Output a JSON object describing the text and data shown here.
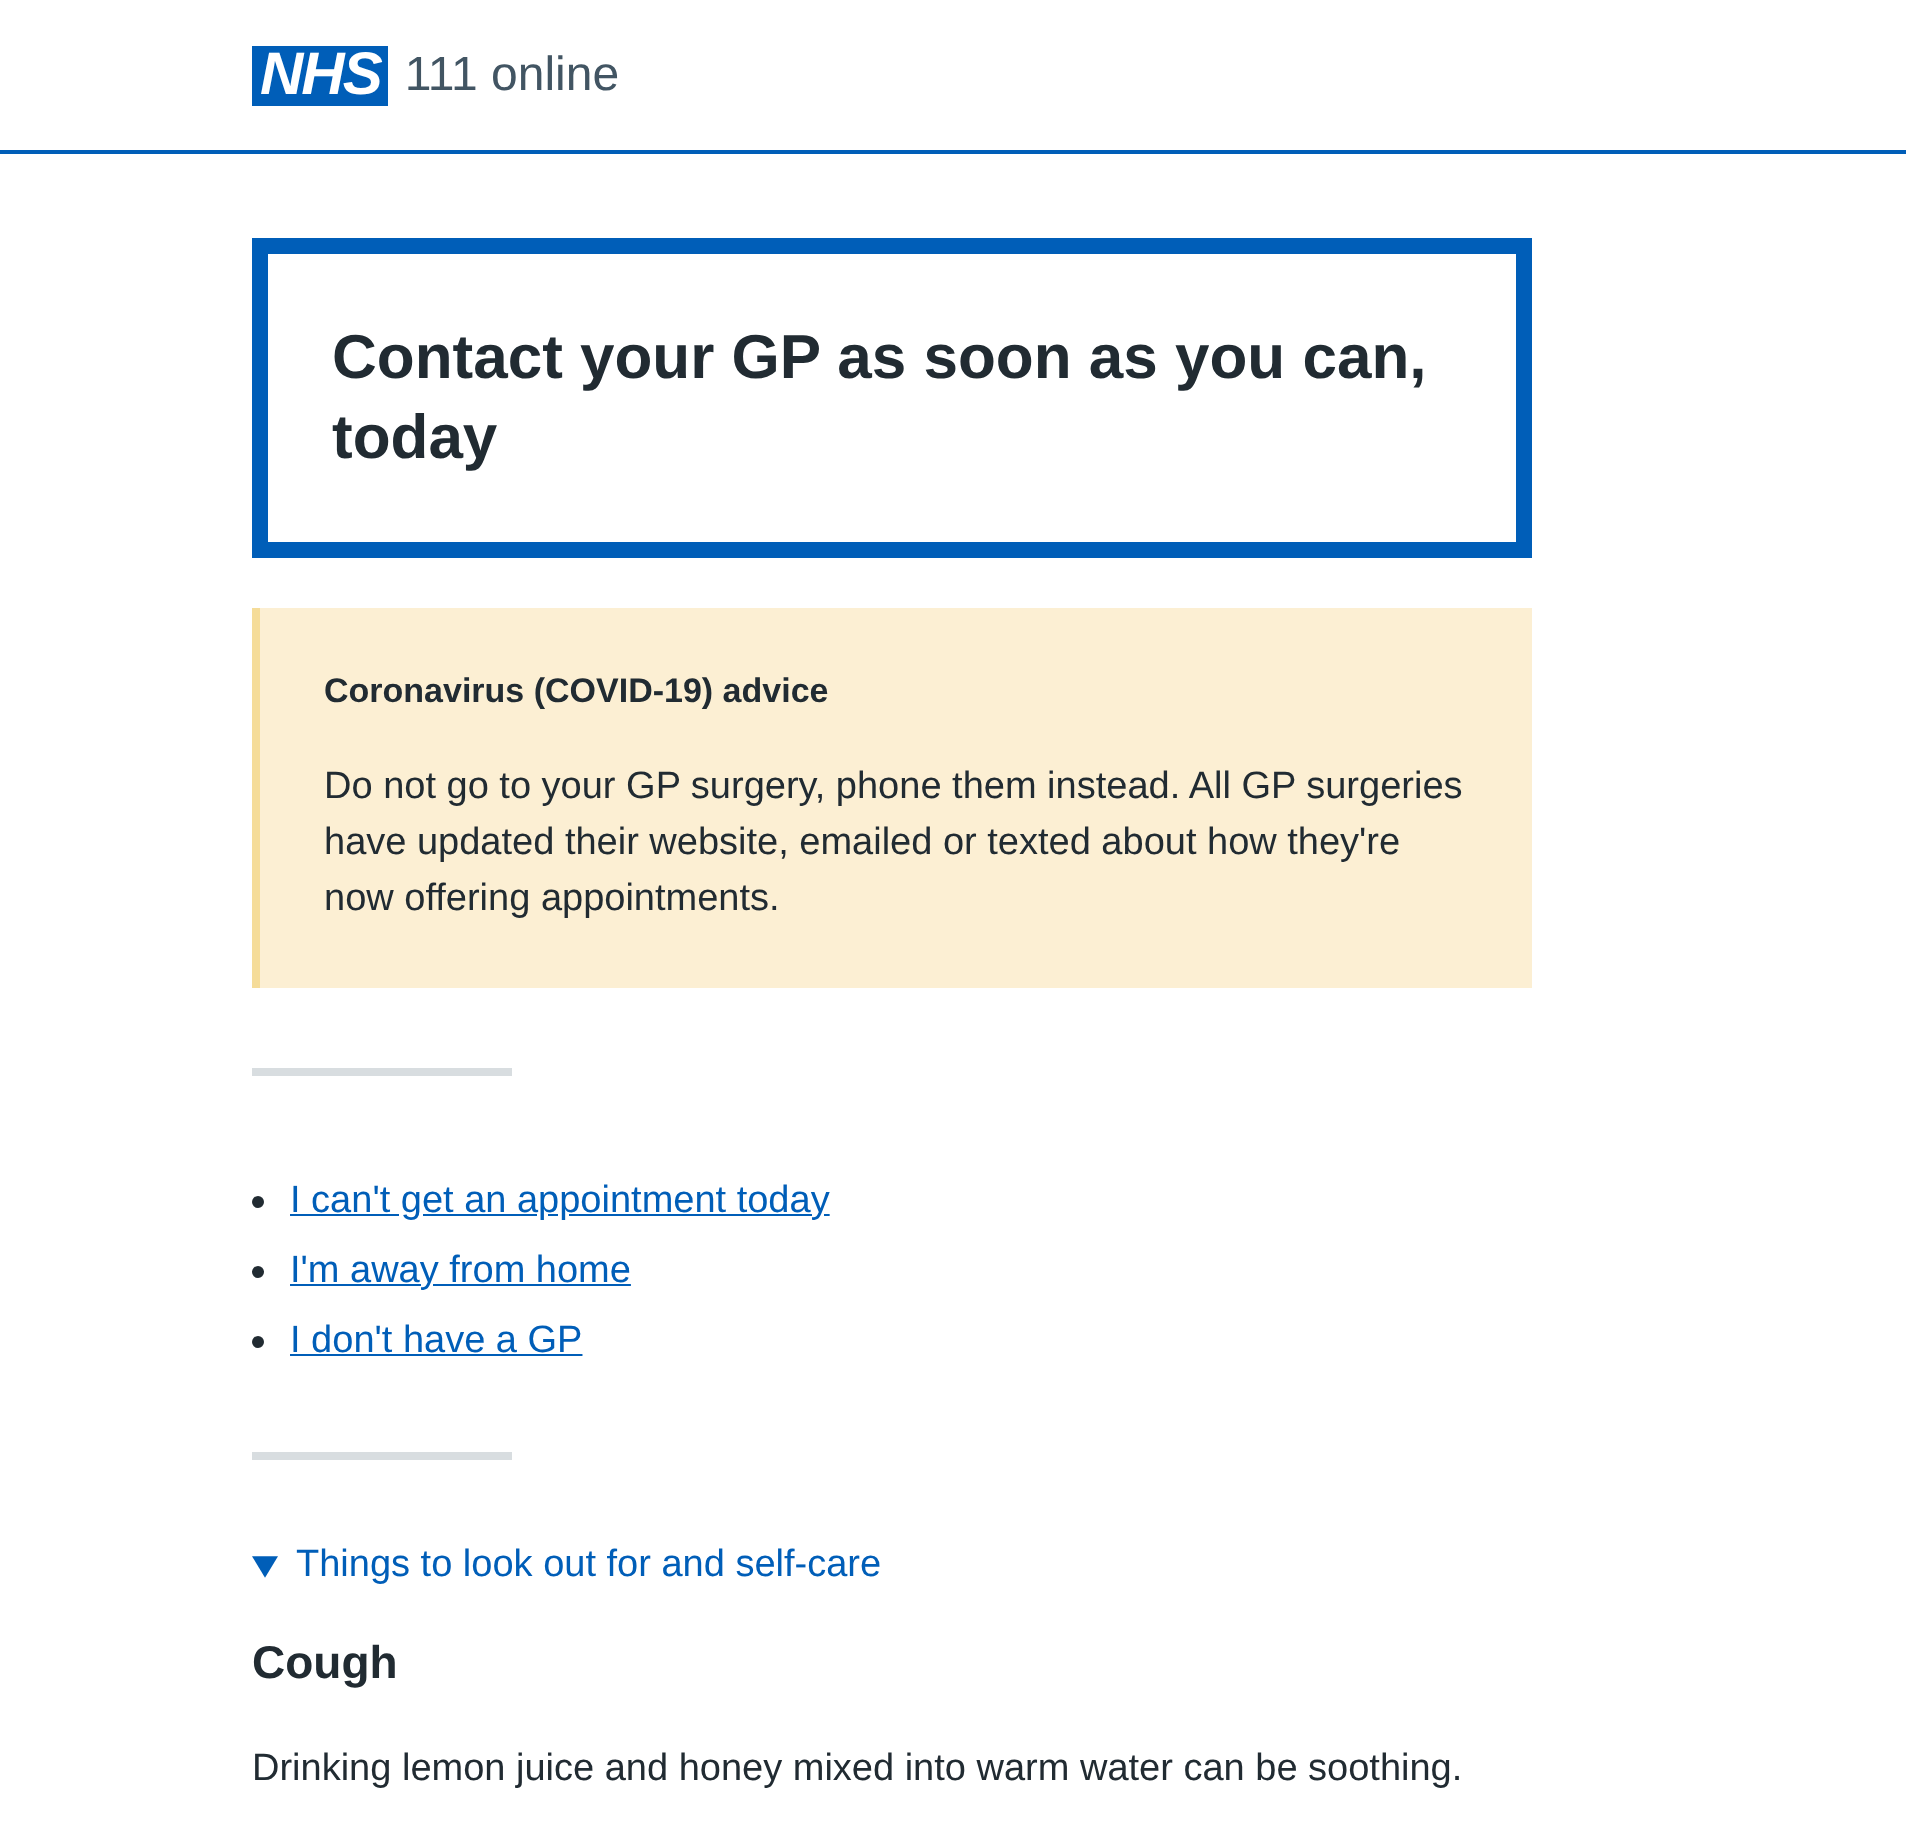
{
  "header": {
    "logo": "NHS",
    "service_name": "111 online"
  },
  "outcome": {
    "title": "Contact your GP as soon as you can, today"
  },
  "callout": {
    "heading": "Coronavirus (COVID-19) advice",
    "body": "Do not go to your GP surgery, phone them instead. All GP surgeries have updated their website, emailed or texted about how they're now offering appointments."
  },
  "links": [
    "I can't get an appointment today",
    "I'm away from home",
    "I don't have a GP"
  ],
  "details": {
    "summary": "Things to look out for and self-care",
    "expanded": true
  },
  "care": [
    {
      "heading": "Cough",
      "body": "Drinking lemon juice and honey mixed into warm water can be soothing."
    }
  ]
}
